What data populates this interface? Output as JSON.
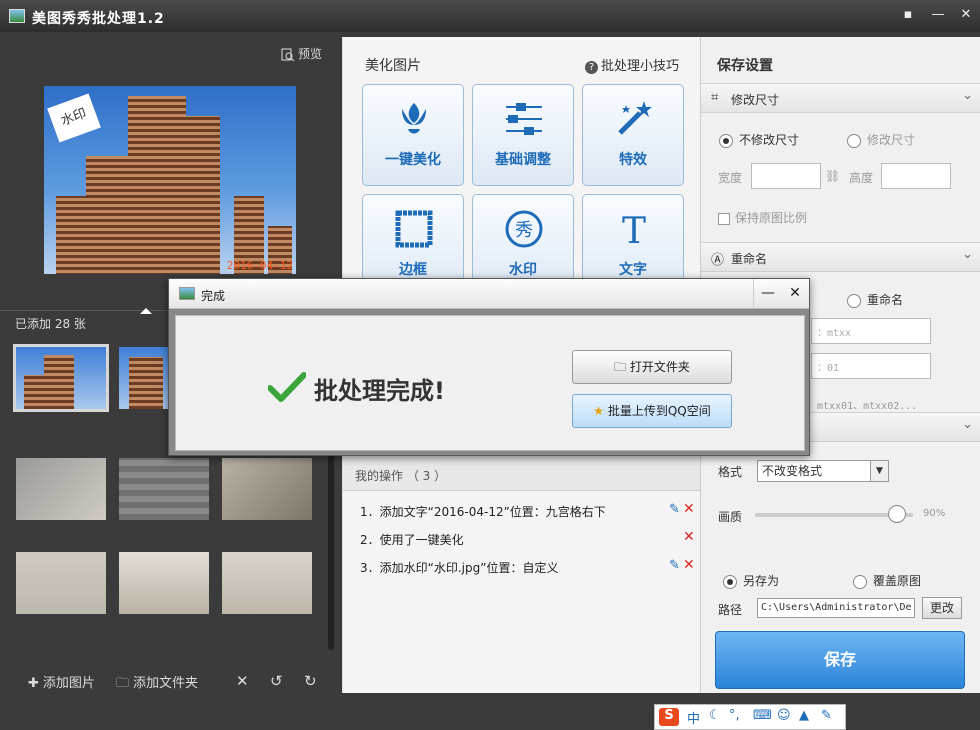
{
  "app": {
    "title": "美图秀秀批处理1.2"
  },
  "left": {
    "preview_label": "预览",
    "photo_date": "2016-04-12",
    "added_count": "已添加 28 张",
    "bottom": {
      "add_image": "添加图片",
      "add_folder": "添加文件夹"
    }
  },
  "beautify": {
    "title": "美化图片",
    "tips": "批处理小技巧",
    "tools": [
      {
        "label": "一键美化",
        "icon": "tulip-icon"
      },
      {
        "label": "基础调整",
        "icon": "sliders-icon"
      },
      {
        "label": "特效",
        "icon": "magic-wand-icon"
      },
      {
        "label": "边框",
        "icon": "frame-icon"
      },
      {
        "label": "水印",
        "icon": "watermark-icon"
      },
      {
        "label": "文字",
        "icon": "text-icon"
      }
    ]
  },
  "ops": {
    "title": "我的操作 （ 3 ）",
    "items": [
      "1．添加文字“2016-04-12”位置：九宫格右下",
      "2．使用了一键美化",
      "3．添加水印“水印.jpg”位置：自定义"
    ]
  },
  "save": {
    "title": "保存设置",
    "resize_head": "修改尺寸",
    "no_resize": "不修改尺寸",
    "resize": "修改尺寸",
    "width_label": "宽度",
    "height_label": "高度",
    "keep_ratio": "保持原图比例",
    "rename_head": "重命名",
    "rename_opt": "重命名",
    "prefix_val": "：mtxx",
    "start_val": "：01",
    "rename_example": "mtxx01、mtxx02...",
    "format_label": "格式",
    "format_value": "不改变格式",
    "quality_label": "画质",
    "quality_value": "90%",
    "quality_level": 0.9,
    "save_as": "另存为",
    "overwrite": "覆盖原图",
    "path_label": "路径",
    "path_value": "C:\\Users\\Administrator\\De:",
    "change_btn": "更改",
    "save_btn": "保存"
  },
  "dialog": {
    "title": "完成",
    "message": "批处理完成!",
    "open_folder": "打开文件夹",
    "upload_qq": "批量上传到QQ空间"
  },
  "statusbar": {
    "brand": "S",
    "mode": "中"
  }
}
